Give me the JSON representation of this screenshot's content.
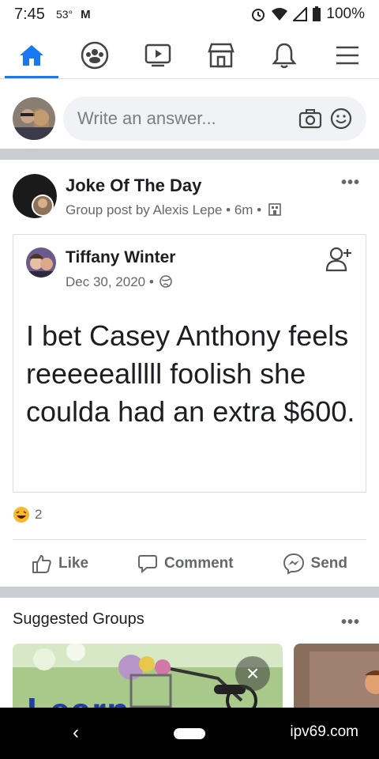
{
  "status_bar": {
    "time": "7:45",
    "temperature": "53°",
    "battery": "100%"
  },
  "nav": {
    "tabs": [
      "home-icon",
      "groups-icon",
      "watch-icon",
      "marketplace-icon",
      "notifications-icon",
      "menu-icon"
    ],
    "active": "home"
  },
  "composer": {
    "placeholder": "Write an answer..."
  },
  "post": {
    "group_name": "Joke Of The Day",
    "meta": "Group post by Alexis Lepe • 6m •",
    "shared": {
      "author": "Tiffany Winter",
      "date": "Dec 30, 2020 •",
      "text": "I bet Casey Anthony feels reeeeealllll foolish she coulda had an extra $600."
    },
    "reactions": {
      "count": "2"
    },
    "actions": {
      "like": "Like",
      "comment": "Comment",
      "send": "Send"
    }
  },
  "suggested": {
    "title": "Suggested Groups",
    "card_text": "Learn"
  },
  "system_bar": {
    "watermark": "ipv69.com"
  },
  "colors": {
    "accent": "#1877f2",
    "secondary_text": "#65676b",
    "divider": "#c9ccd1"
  }
}
